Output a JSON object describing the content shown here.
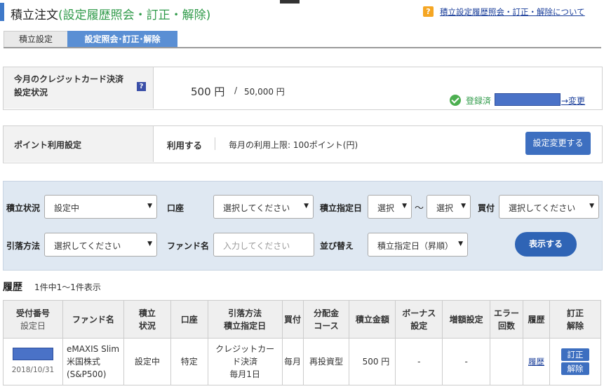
{
  "header": {
    "title_main": "積立注文",
    "title_sub": "(設定履歴照会・訂正・解除)",
    "help_badge": "?",
    "help_link": "積立設定履歴照会・訂正・解除について"
  },
  "tabs": [
    {
      "label": "積立設定"
    },
    {
      "label": "設定照会･訂正･解除"
    }
  ],
  "credit_card": {
    "label_line1": "今月のクレジットカード決済",
    "label_line2": "設定状況",
    "help_badge": "?",
    "amount": "500 円",
    "slash": "/",
    "limit": "50,000 円",
    "status": "登録済",
    "change_link": "→変更"
  },
  "points": {
    "label": "ポイント利用設定",
    "use": "利用する",
    "limit": "毎月の利用上限: 100ポイント(円)",
    "button": "設定変更する"
  },
  "filter": {
    "status_label": "積立状況",
    "status_value": "設定中",
    "account_label": "口座",
    "account_value": "選択してください",
    "date_label": "積立指定日",
    "date_from": "選択",
    "tilde": "〜",
    "date_to": "選択",
    "buy_label": "買付",
    "buy_value": "選択してください",
    "method_label": "引落方法",
    "method_value": "選択してください",
    "fund_label": "ファンド名",
    "fund_placeholder": "入力してください",
    "sort_label": "並び替え",
    "sort_value": "積立指定日（昇順）",
    "show_button": "表示する",
    "arrow": "▼"
  },
  "history": {
    "title": "履歴",
    "count": "1件中1〜1件表示",
    "columns": {
      "receipt": "受付番号",
      "setdate": "設定日",
      "fund": "ファンド名",
      "status1": "積立",
      "status2": "状況",
      "account": "口座",
      "method1": "引落方法",
      "method2": "積立指定日",
      "buy": "買付",
      "dist1": "分配金",
      "dist2": "コース",
      "amount": "積立金額",
      "bonus1": "ボーナス",
      "bonus2": "設定",
      "increase": "増額設定",
      "error1": "エラー",
      "error2": "回数",
      "history": "履歴",
      "edit1": "訂正",
      "edit2": "解除"
    },
    "rows": [
      {
        "date": "2018/10/31",
        "fund1": "eMAXIS Slim",
        "fund2": "米国株式",
        "fund3": "(S&P500)",
        "status": "設定中",
        "account": "特定",
        "method1": "クレジットカー",
        "method2": "ド決済",
        "method3": "毎月1日",
        "buy": "毎月",
        "dist": "再投資型",
        "amount": "500 円",
        "bonus": "-",
        "increase": "-",
        "error": "",
        "history_link": "履歴",
        "edit_button": "訂正",
        "cancel_button": "解除"
      }
    ]
  }
}
